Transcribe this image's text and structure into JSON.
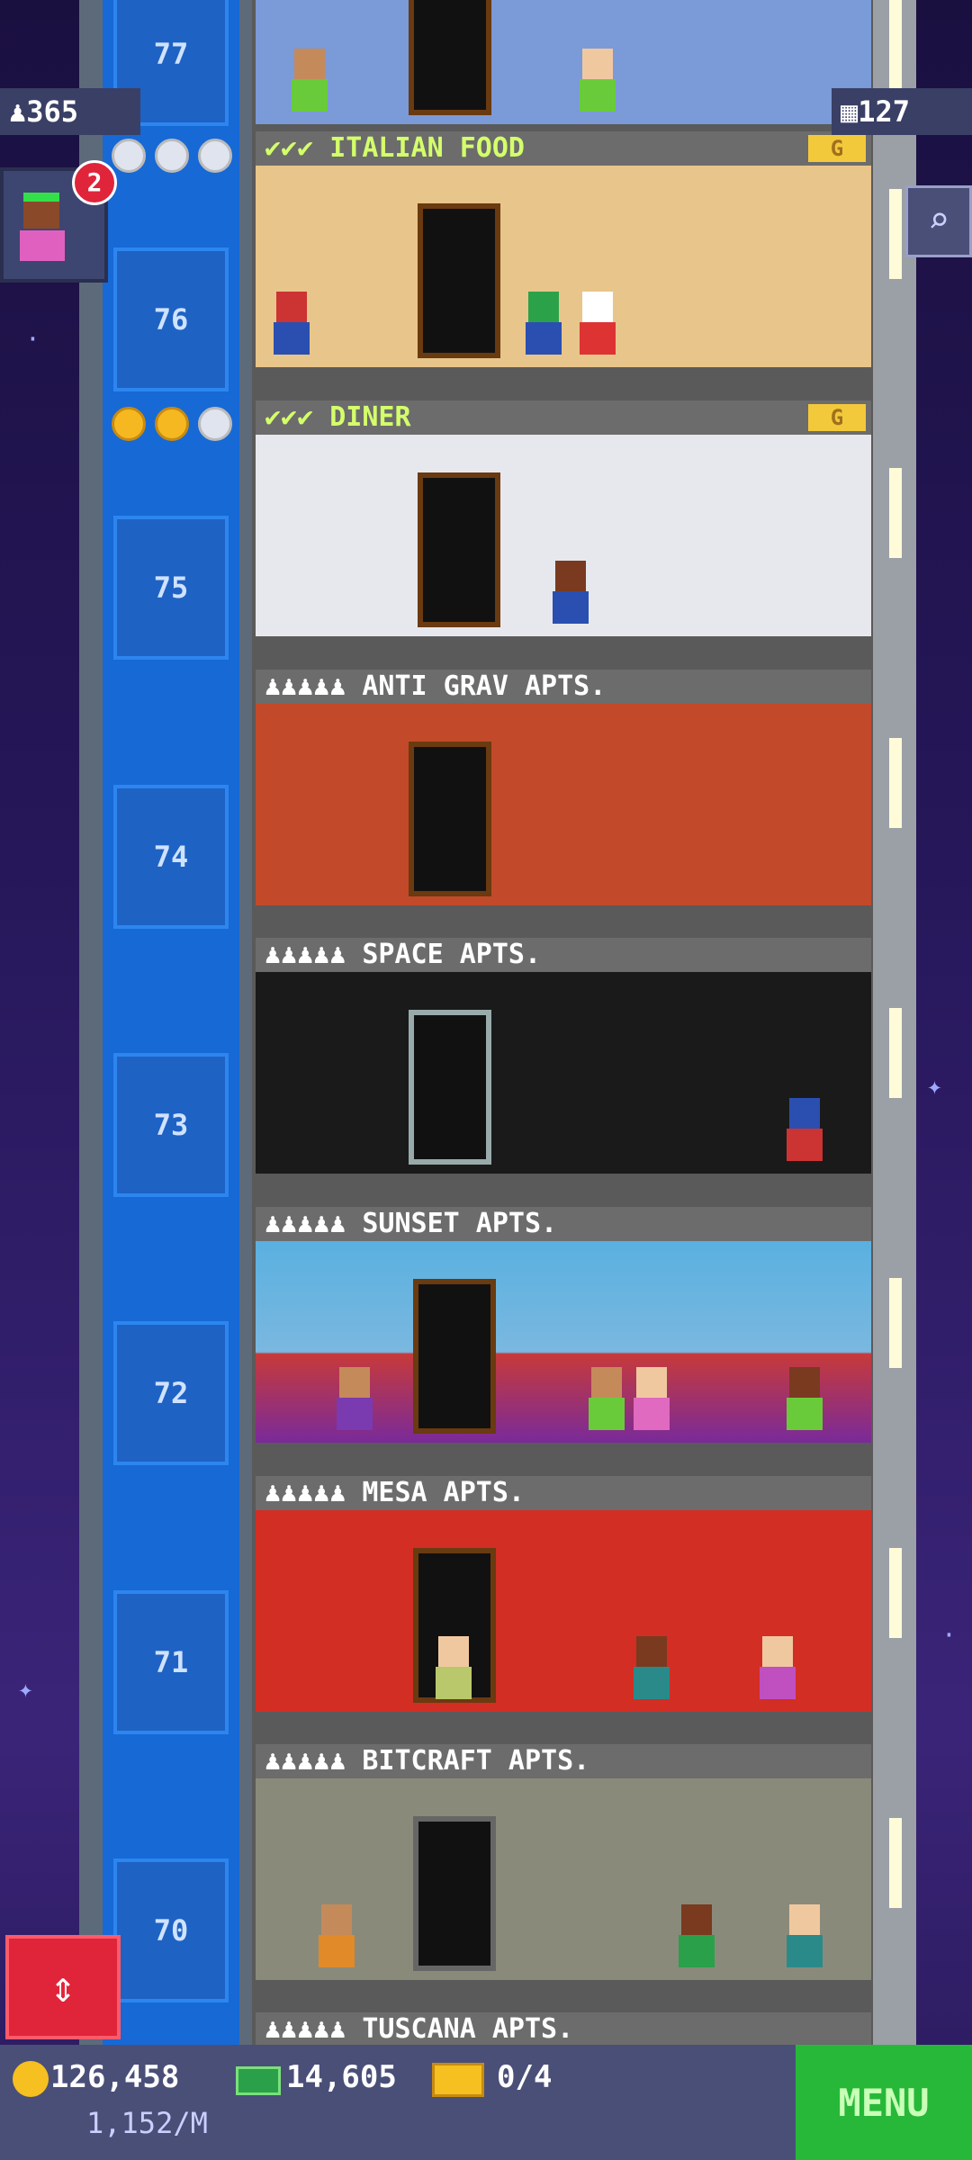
{
  "stats": {
    "population": "365",
    "floors": "127",
    "notification_count": "2"
  },
  "floors": [
    {
      "number": "77",
      "name": ""
    },
    {
      "number": "76",
      "name": "ITALIAN FOOD",
      "type": "business",
      "checks": "✔✔✔",
      "level": "G"
    },
    {
      "number": "75",
      "name": "DINER",
      "type": "business",
      "checks": "✔✔✔",
      "level": "G"
    },
    {
      "number": "74",
      "name": "ANTI GRAV APTS.",
      "type": "residential",
      "icons": "♟♟♟♟♟"
    },
    {
      "number": "73",
      "name": "SPACE APTS.",
      "type": "residential",
      "icons": "♟♟♟♟♟"
    },
    {
      "number": "72",
      "name": "SUNSET APTS.",
      "type": "residential",
      "icons": "♟♟♟♟♟"
    },
    {
      "number": "71",
      "name": "MESA APTS.",
      "type": "residential",
      "icons": "♟♟♟♟♟"
    },
    {
      "number": "70",
      "name": "BITCRAFT APTS.",
      "type": "residential",
      "icons": "♟♟♟♟♟"
    }
  ],
  "next_floor_label": "TUSCANA APTS.",
  "bottom": {
    "coins": "126,458",
    "coins_rate": "1,152/M",
    "bux": "14,605",
    "tickets": "0/4",
    "menu_label": "MENU"
  },
  "colors": {
    "elevator": "#1769d6",
    "menu": "#27b83a",
    "accent_text": "#d4ff6b"
  }
}
